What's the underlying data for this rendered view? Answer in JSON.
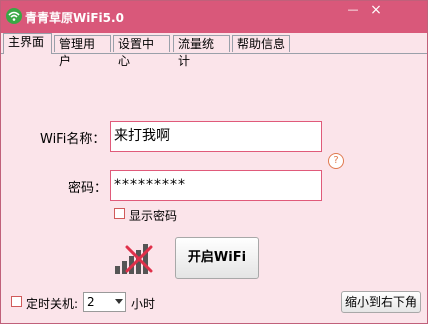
{
  "window": {
    "title": "青青草原WiFi5.0",
    "minimize_label": "—",
    "close_label": "×"
  },
  "tabs": [
    {
      "label": "主界面",
      "active": true
    },
    {
      "label": "管理用户",
      "active": false
    },
    {
      "label": "设置中心",
      "active": false
    },
    {
      "label": "流量统计",
      "active": false
    },
    {
      "label": "帮助信息",
      "active": false
    }
  ],
  "form": {
    "wifi_name_label": "WiFi名称：",
    "wifi_name_value": "来打我啊",
    "password_label": "密码：",
    "password_value": "*********",
    "show_password_label": "显示密码",
    "show_password_checked": false,
    "help_symbol": "?"
  },
  "actions": {
    "start_wifi_label": "开启WiFi",
    "minimize_to_tray_label": "缩小到右下角"
  },
  "timer": {
    "label": "定时关机:",
    "checked": false,
    "selected_value": "2",
    "unit": "小时"
  },
  "status": {
    "signal_icon": "signal-off-icon"
  },
  "colors": {
    "titlebar": "#d9587a",
    "background": "#fbe4ea",
    "input_border": "#e05a7a",
    "accent_red": "#e0304a"
  }
}
